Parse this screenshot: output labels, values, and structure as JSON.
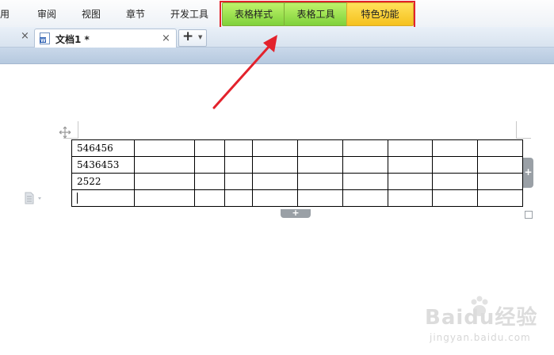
{
  "menubar": {
    "items": [
      "用",
      "审阅",
      "视图",
      "章节",
      "开发工具"
    ],
    "context_tabs": {
      "table_style": "表格样式",
      "table_tools": "表格工具",
      "special": "特色功能"
    }
  },
  "tabs": {
    "close_glyph": "×",
    "document_title": "文档1 *",
    "new_tab_glyph": "+",
    "dropdown_glyph": "▼"
  },
  "table": {
    "rows": [
      [
        "546456",
        "",
        "",
        "",
        "",
        "",
        "",
        "",
        "",
        ""
      ],
      [
        "5436453",
        "",
        "",
        "",
        "",
        "",
        "",
        "",
        "",
        ""
      ],
      [
        "2522",
        "",
        "",
        "",
        "",
        "",
        "",
        "",
        "",
        ""
      ],
      [
        "",
        "",
        "",
        "",
        "",
        "",
        "",
        "",
        "",
        ""
      ]
    ],
    "add_glyph": "+"
  },
  "watermark": {
    "brand": "Baidu经验",
    "url": "jingyan.baidu.com"
  },
  "colors": {
    "highlight": "#e3222c",
    "green_tab": "#7fd13b",
    "yellow_tab": "#f5c11e"
  }
}
